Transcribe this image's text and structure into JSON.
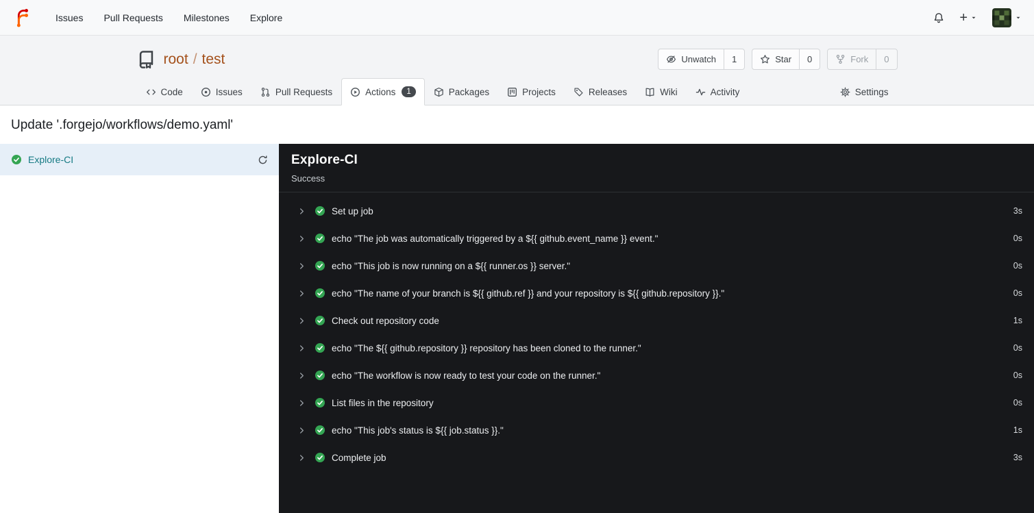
{
  "colors": {
    "accent_orange": "#ff6600",
    "logo_red": "#d40000",
    "repo_link": "#a4511c",
    "success_green": "#34a553",
    "sidebar_selected_bg": "#e6eff8",
    "sidebar_job_link": "#157a83",
    "panel_bg": "#17181b",
    "badge_bg": "#45494e"
  },
  "icons": {
    "forgejo-logo": "branch F mark",
    "bell-icon": "notifications bell outline",
    "plus-icon": "+",
    "caret-down-icon": "▾",
    "avatar": "pixel-art user avatar",
    "repo-icon": "book",
    "eye-slash-icon": "unwatch eye with slash",
    "star-icon": "star outline",
    "fork-icon": "git fork",
    "code-icon": "</>",
    "issue-icon": "circle with dot",
    "pull-request-icon": "git pull request",
    "play-circle-icon": "play in circle",
    "package-icon": "box",
    "project-icon": "board with columns",
    "tag-icon": "tag",
    "book-open-icon": "open book",
    "pulse-icon": "activity pulse line",
    "gear-icon": "settings gear",
    "sync-icon": "circular refresh arrow",
    "chevron-right-icon": "›",
    "check-circle-icon": "green circle with white check"
  },
  "navbar": {
    "items": [
      {
        "label": "Issues"
      },
      {
        "label": "Pull Requests"
      },
      {
        "label": "Milestones"
      },
      {
        "label": "Explore"
      }
    ]
  },
  "repo": {
    "owner": "root",
    "separator": "/",
    "name": "test",
    "buttons": {
      "unwatch": {
        "label": "Unwatch",
        "count": "1"
      },
      "star": {
        "label": "Star",
        "count": "0"
      },
      "fork": {
        "label": "Fork",
        "count": "0"
      }
    },
    "tabs": [
      {
        "label": "Code"
      },
      {
        "label": "Issues"
      },
      {
        "label": "Pull Requests"
      },
      {
        "label": "Actions",
        "badge": "1"
      },
      {
        "label": "Packages"
      },
      {
        "label": "Projects"
      },
      {
        "label": "Releases"
      },
      {
        "label": "Wiki"
      },
      {
        "label": "Activity"
      },
      {
        "label": "Settings"
      }
    ]
  },
  "run": {
    "title": "Update '.forgejo/workflows/demo.yaml'",
    "job": {
      "name": "Explore-CI",
      "status": "Success"
    },
    "sidebar_jobs": [
      {
        "name": "Explore-CI"
      }
    ],
    "steps": [
      {
        "name": "Set up job",
        "duration": "3s"
      },
      {
        "name": "echo \"The job was automatically triggered by a ${{ github.event_name }} event.\"",
        "duration": "0s"
      },
      {
        "name": "echo \"This job is now running on a ${{ runner.os }} server.\"",
        "duration": "0s"
      },
      {
        "name": "echo \"The name of your branch is ${{ github.ref }} and your repository is ${{ github.repository }}.\"",
        "duration": "0s"
      },
      {
        "name": "Check out repository code",
        "duration": "1s"
      },
      {
        "name": "echo \"The ${{ github.repository }} repository has been cloned to the runner.\"",
        "duration": "0s"
      },
      {
        "name": "echo \"The workflow is now ready to test your code on the runner.\"",
        "duration": "0s"
      },
      {
        "name": "List files in the repository",
        "duration": "0s"
      },
      {
        "name": "echo \"This job's status is ${{ job.status }}.\"",
        "duration": "1s"
      },
      {
        "name": "Complete job",
        "duration": "3s"
      }
    ]
  }
}
